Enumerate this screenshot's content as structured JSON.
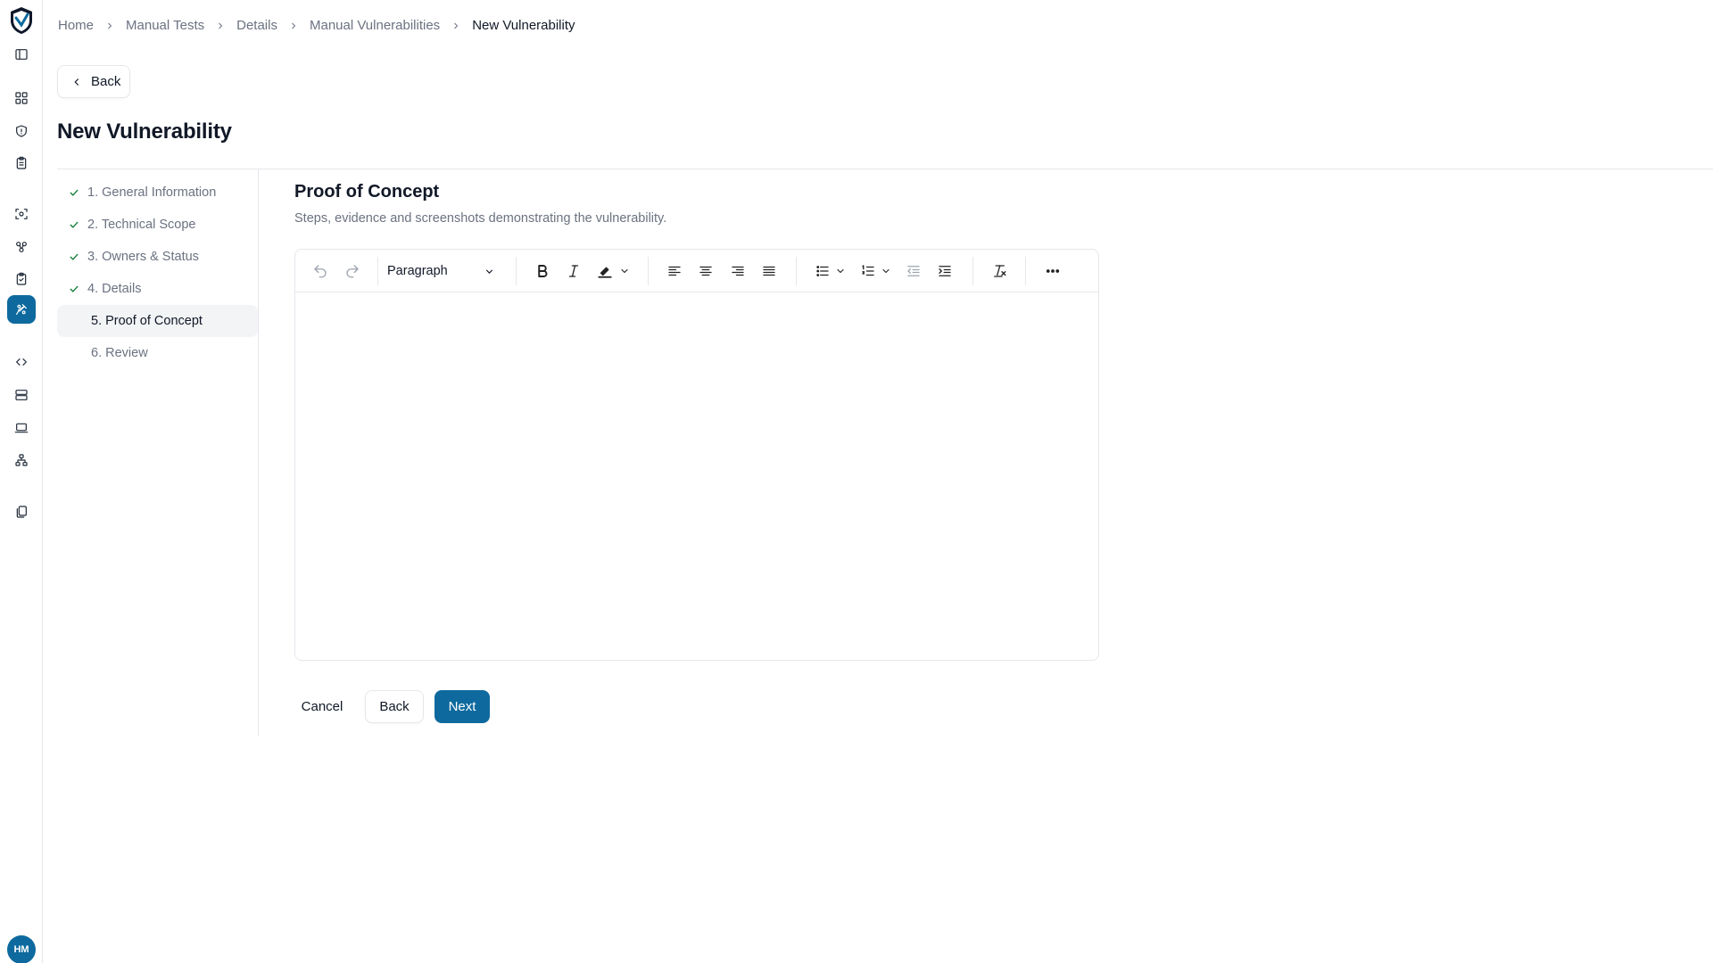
{
  "breadcrumb": [
    "Home",
    "Manual Tests",
    "Details",
    "Manual Vulnerabilities",
    "New Vulnerability"
  ],
  "back_button": "Back",
  "page_title": "New Vulnerability",
  "steps": [
    {
      "label": "1. General Information",
      "done": true
    },
    {
      "label": "2. Technical Scope",
      "done": true
    },
    {
      "label": "3. Owners & Status",
      "done": true
    },
    {
      "label": "4. Details",
      "done": true
    },
    {
      "label": "5. Proof of Concept",
      "done": false,
      "active": true
    },
    {
      "label": "6. Review",
      "done": false
    }
  ],
  "section": {
    "title": "Proof of Concept",
    "description": "Steps, evidence and screenshots demonstrating the vulnerability."
  },
  "editor": {
    "block_format": "Paragraph",
    "content": ""
  },
  "actions": {
    "cancel": "Cancel",
    "back": "Back",
    "next": "Next"
  },
  "user": {
    "initials": "HM"
  },
  "colors": {
    "primary": "#0e6a9e",
    "check": "#15803d",
    "muted_text": "#6b7280"
  }
}
